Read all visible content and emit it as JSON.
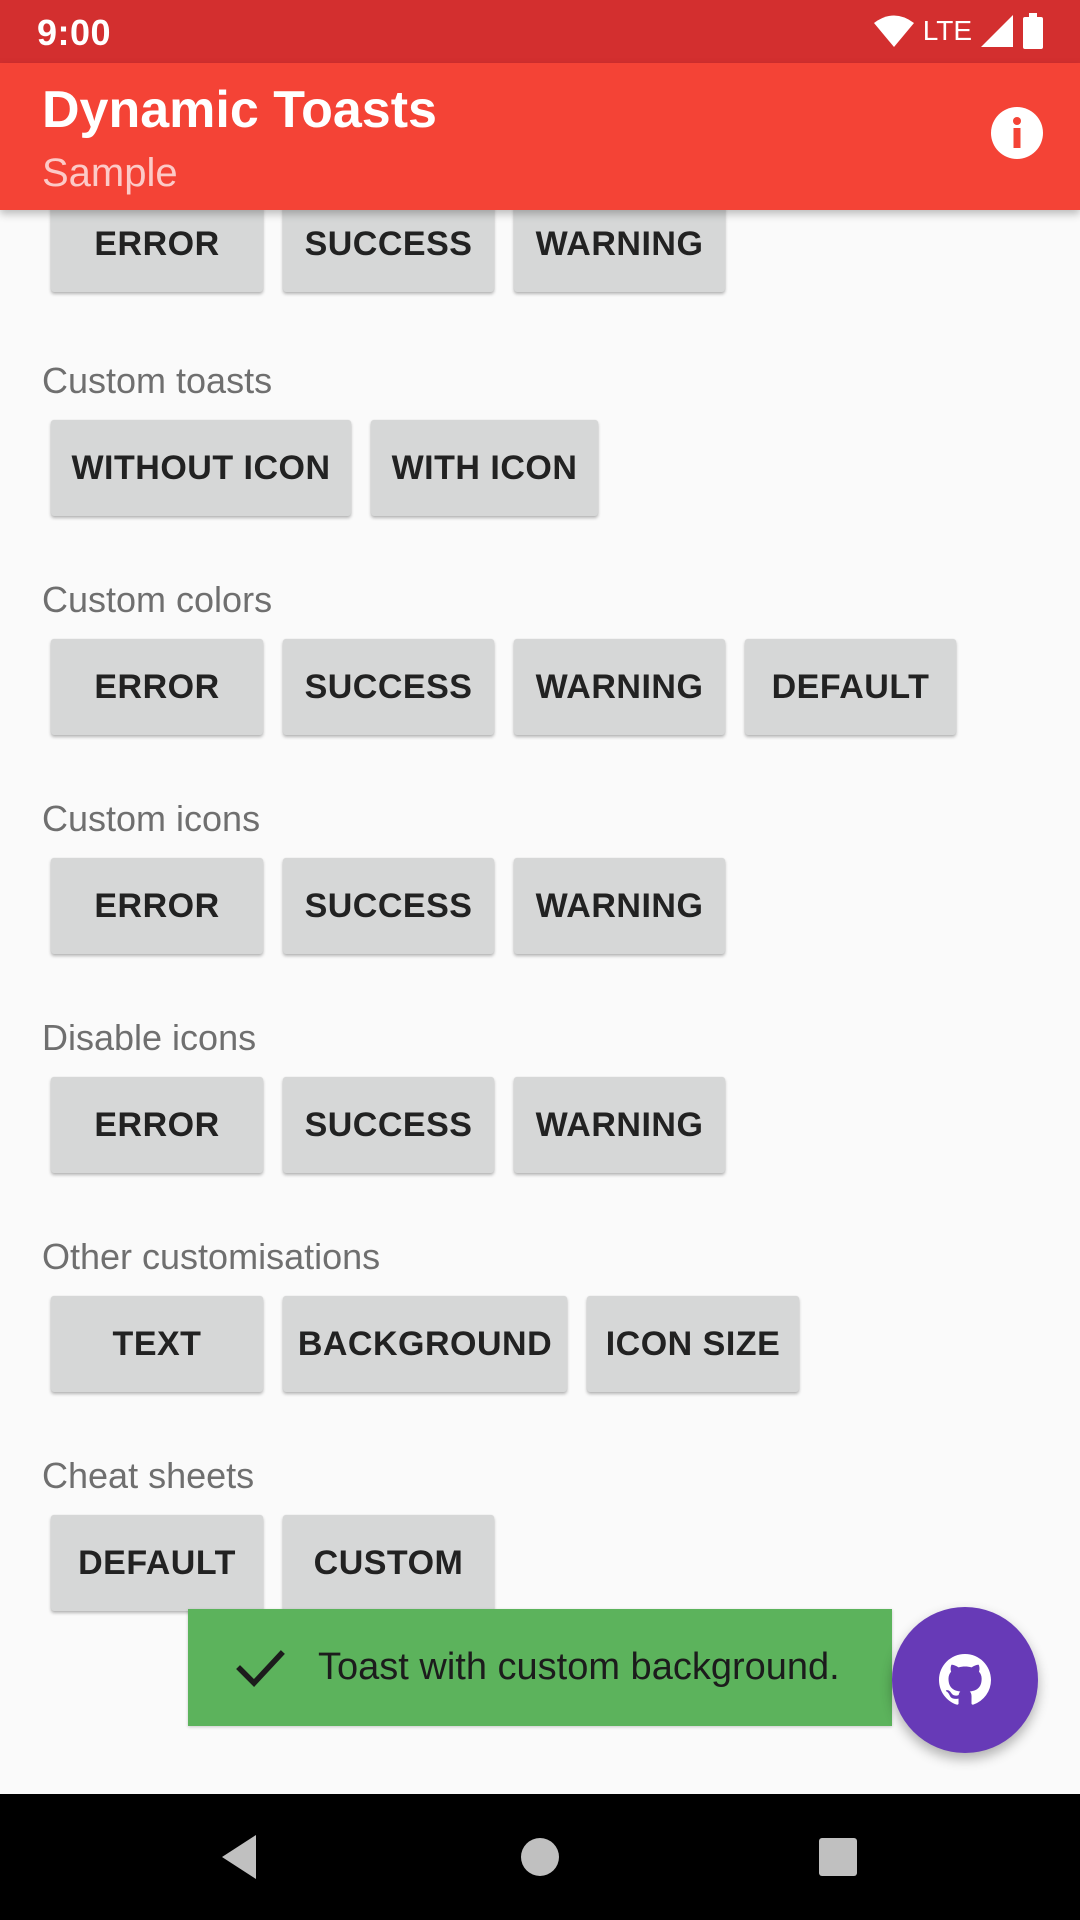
{
  "status_bar": {
    "time": "9:00",
    "network_label": "LTE",
    "icons": [
      "wifi-icon",
      "signal-icon",
      "battery-icon"
    ]
  },
  "app_bar": {
    "title": "Dynamic Toasts",
    "subtitle": "Sample",
    "action_icon": "info-icon",
    "color": "#f44336",
    "status_color": "#d32f2f"
  },
  "top_row": {
    "error": "ERROR",
    "success": "SUCCESS",
    "warning": "WARNING"
  },
  "custom_toasts": {
    "label": "Custom toasts",
    "without_icon": "WITHOUT ICON",
    "with_icon": "WITH ICON"
  },
  "custom_colors": {
    "label": "Custom colors",
    "error": "ERROR",
    "success": "SUCCESS",
    "warning": "WARNING",
    "default": "DEFAULT"
  },
  "custom_icons": {
    "label": "Custom icons",
    "error": "ERROR",
    "success": "SUCCESS",
    "warning": "WARNING"
  },
  "disable_icons": {
    "label": "Disable icons",
    "error": "ERROR",
    "success": "SUCCESS",
    "warning": "WARNING"
  },
  "other_customisations": {
    "label": "Other customisations",
    "text": "TEXT",
    "background": "BACKGROUND",
    "icon_size": "ICON SIZE"
  },
  "cheat_sheets": {
    "label": "Cheat sheets",
    "default": "DEFAULT",
    "custom": "CUSTOM"
  },
  "toast": {
    "icon": "check-icon",
    "message": "Toast with custom background.",
    "background_color": "#5cb35c"
  },
  "fab": {
    "icon": "github-icon",
    "color": "#673ab7"
  },
  "nav_bar": {
    "icons": [
      "back-icon",
      "home-icon",
      "recents-icon"
    ]
  }
}
